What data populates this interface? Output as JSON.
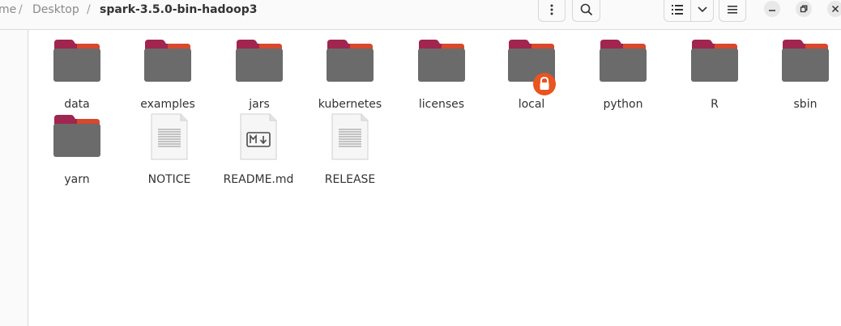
{
  "breadcrumb": {
    "items": [
      "me",
      "Desktop",
      "spark-3.5.0-bin-hadoop3"
    ],
    "separator": "/"
  },
  "toolbar": {
    "icons": [
      "more-vertical-icon",
      "search-icon",
      "list-view-icon",
      "chevron-down-icon",
      "hamburger-menu-icon"
    ]
  },
  "window_controls": {
    "icons": [
      "minimize-icon",
      "restore-icon",
      "close-icon"
    ]
  },
  "files": [
    {
      "name": "data",
      "type": "folder"
    },
    {
      "name": "examples",
      "type": "folder"
    },
    {
      "name": "jars",
      "type": "folder"
    },
    {
      "name": "kubernetes",
      "type": "folder"
    },
    {
      "name": "licenses",
      "type": "folder"
    },
    {
      "name": "local",
      "type": "folder",
      "badge": "lock-icon"
    },
    {
      "name": "python",
      "type": "folder"
    },
    {
      "name": "R",
      "type": "folder"
    },
    {
      "name": "sbin",
      "type": "folder"
    },
    {
      "name": "yarn",
      "type": "folder"
    },
    {
      "name": "NOTICE",
      "type": "text-file"
    },
    {
      "name": "README.md",
      "type": "markdown-file"
    },
    {
      "name": "RELEASE",
      "type": "text-file"
    }
  ],
  "colors": {
    "folder_body": "#6b6b6b",
    "folder_tab": "#a0254f",
    "folder_tab_accent": "#e95420",
    "lock_badge": "#e95420"
  }
}
